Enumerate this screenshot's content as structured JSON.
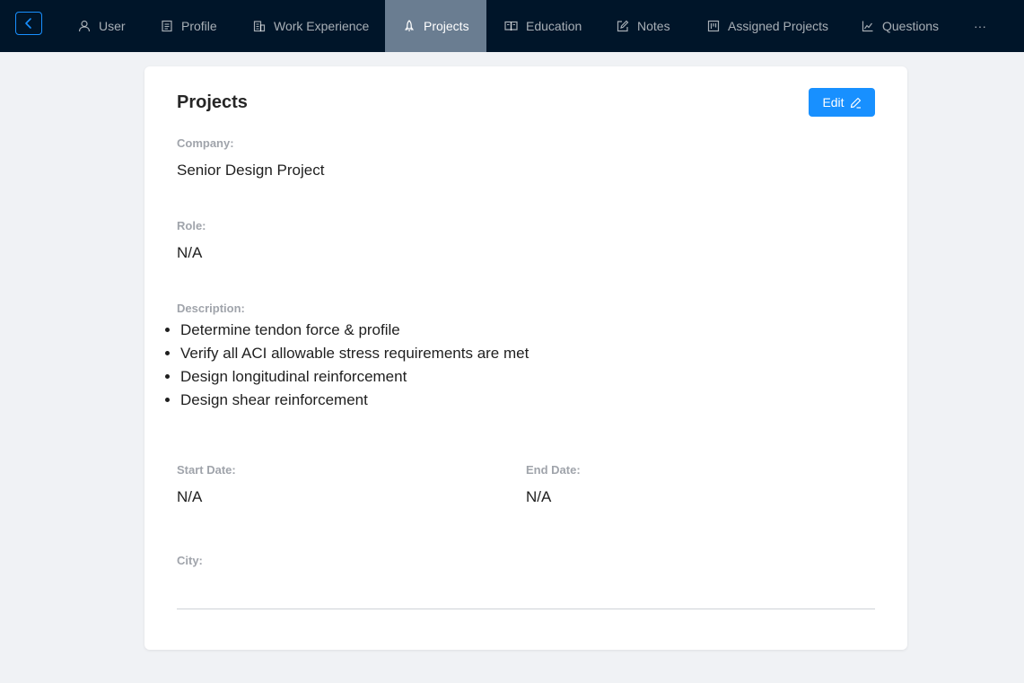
{
  "nav": {
    "back_icon": "chevron-left-icon",
    "items": [
      {
        "label": "User",
        "icon": "user-icon"
      },
      {
        "label": "Profile",
        "icon": "profile-icon"
      },
      {
        "label": "Work Experience",
        "icon": "building-icon"
      },
      {
        "label": "Projects",
        "icon": "rocket-icon",
        "active": true
      },
      {
        "label": "Education",
        "icon": "book-icon"
      },
      {
        "label": "Notes",
        "icon": "edit-icon"
      },
      {
        "label": "Assigned Projects",
        "icon": "project-icon"
      },
      {
        "label": "Questions",
        "icon": "chart-icon"
      }
    ],
    "more_label": "···"
  },
  "card": {
    "title": "Projects",
    "edit_label": "Edit",
    "company_label": "Company:",
    "company_value": "Senior Design Project",
    "role_label": "Role:",
    "role_value": "N/A",
    "description_label": "Description:",
    "description_items": [
      "Determine tendon force & profile",
      "Verify all ACI allowable stress requirements are met",
      "Design longitudinal reinforcement",
      "Design shear reinforcement"
    ],
    "start_date_label": "Start Date:",
    "start_date_value": "N/A",
    "end_date_label": "End Date:",
    "end_date_value": "N/A",
    "city_label": "City:",
    "city_value": ""
  },
  "colors": {
    "nav_bg": "#001529",
    "nav_active": "#6a7d91",
    "accent": "#1890ff",
    "page_bg": "#f0f2f5"
  }
}
